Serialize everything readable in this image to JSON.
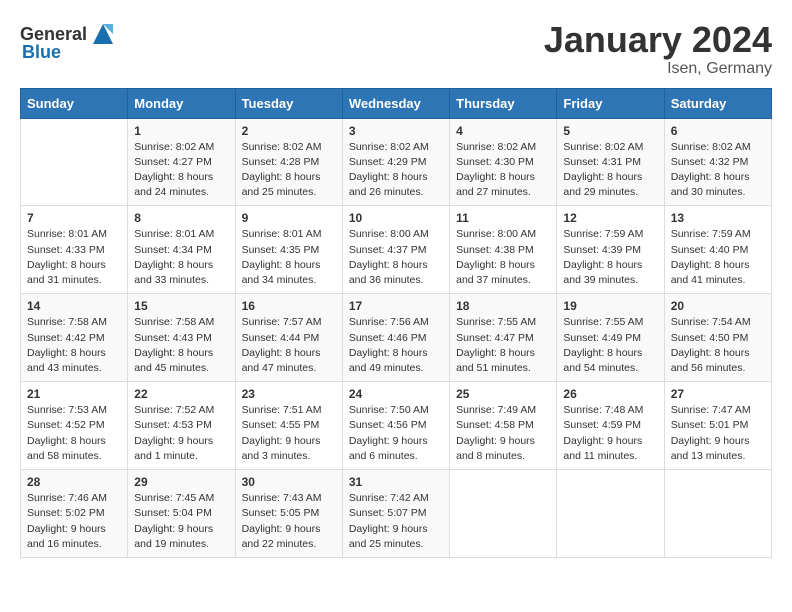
{
  "header": {
    "logo_general": "General",
    "logo_blue": "Blue",
    "month_title": "January 2024",
    "location": "Isen, Germany"
  },
  "weekdays": [
    "Sunday",
    "Monday",
    "Tuesday",
    "Wednesday",
    "Thursday",
    "Friday",
    "Saturday"
  ],
  "weeks": [
    [
      {
        "day": "",
        "info": ""
      },
      {
        "day": "1",
        "info": "Sunrise: 8:02 AM\nSunset: 4:27 PM\nDaylight: 8 hours\nand 24 minutes."
      },
      {
        "day": "2",
        "info": "Sunrise: 8:02 AM\nSunset: 4:28 PM\nDaylight: 8 hours\nand 25 minutes."
      },
      {
        "day": "3",
        "info": "Sunrise: 8:02 AM\nSunset: 4:29 PM\nDaylight: 8 hours\nand 26 minutes."
      },
      {
        "day": "4",
        "info": "Sunrise: 8:02 AM\nSunset: 4:30 PM\nDaylight: 8 hours\nand 27 minutes."
      },
      {
        "day": "5",
        "info": "Sunrise: 8:02 AM\nSunset: 4:31 PM\nDaylight: 8 hours\nand 29 minutes."
      },
      {
        "day": "6",
        "info": "Sunrise: 8:02 AM\nSunset: 4:32 PM\nDaylight: 8 hours\nand 30 minutes."
      }
    ],
    [
      {
        "day": "7",
        "info": "Sunrise: 8:01 AM\nSunset: 4:33 PM\nDaylight: 8 hours\nand 31 minutes."
      },
      {
        "day": "8",
        "info": "Sunrise: 8:01 AM\nSunset: 4:34 PM\nDaylight: 8 hours\nand 33 minutes."
      },
      {
        "day": "9",
        "info": "Sunrise: 8:01 AM\nSunset: 4:35 PM\nDaylight: 8 hours\nand 34 minutes."
      },
      {
        "day": "10",
        "info": "Sunrise: 8:00 AM\nSunset: 4:37 PM\nDaylight: 8 hours\nand 36 minutes."
      },
      {
        "day": "11",
        "info": "Sunrise: 8:00 AM\nSunset: 4:38 PM\nDaylight: 8 hours\nand 37 minutes."
      },
      {
        "day": "12",
        "info": "Sunrise: 7:59 AM\nSunset: 4:39 PM\nDaylight: 8 hours\nand 39 minutes."
      },
      {
        "day": "13",
        "info": "Sunrise: 7:59 AM\nSunset: 4:40 PM\nDaylight: 8 hours\nand 41 minutes."
      }
    ],
    [
      {
        "day": "14",
        "info": "Sunrise: 7:58 AM\nSunset: 4:42 PM\nDaylight: 8 hours\nand 43 minutes."
      },
      {
        "day": "15",
        "info": "Sunrise: 7:58 AM\nSunset: 4:43 PM\nDaylight: 8 hours\nand 45 minutes."
      },
      {
        "day": "16",
        "info": "Sunrise: 7:57 AM\nSunset: 4:44 PM\nDaylight: 8 hours\nand 47 minutes."
      },
      {
        "day": "17",
        "info": "Sunrise: 7:56 AM\nSunset: 4:46 PM\nDaylight: 8 hours\nand 49 minutes."
      },
      {
        "day": "18",
        "info": "Sunrise: 7:55 AM\nSunset: 4:47 PM\nDaylight: 8 hours\nand 51 minutes."
      },
      {
        "day": "19",
        "info": "Sunrise: 7:55 AM\nSunset: 4:49 PM\nDaylight: 8 hours\nand 54 minutes."
      },
      {
        "day": "20",
        "info": "Sunrise: 7:54 AM\nSunset: 4:50 PM\nDaylight: 8 hours\nand 56 minutes."
      }
    ],
    [
      {
        "day": "21",
        "info": "Sunrise: 7:53 AM\nSunset: 4:52 PM\nDaylight: 8 hours\nand 58 minutes."
      },
      {
        "day": "22",
        "info": "Sunrise: 7:52 AM\nSunset: 4:53 PM\nDaylight: 9 hours\nand 1 minute."
      },
      {
        "day": "23",
        "info": "Sunrise: 7:51 AM\nSunset: 4:55 PM\nDaylight: 9 hours\nand 3 minutes."
      },
      {
        "day": "24",
        "info": "Sunrise: 7:50 AM\nSunset: 4:56 PM\nDaylight: 9 hours\nand 6 minutes."
      },
      {
        "day": "25",
        "info": "Sunrise: 7:49 AM\nSunset: 4:58 PM\nDaylight: 9 hours\nand 8 minutes."
      },
      {
        "day": "26",
        "info": "Sunrise: 7:48 AM\nSunset: 4:59 PM\nDaylight: 9 hours\nand 11 minutes."
      },
      {
        "day": "27",
        "info": "Sunrise: 7:47 AM\nSunset: 5:01 PM\nDaylight: 9 hours\nand 13 minutes."
      }
    ],
    [
      {
        "day": "28",
        "info": "Sunrise: 7:46 AM\nSunset: 5:02 PM\nDaylight: 9 hours\nand 16 minutes."
      },
      {
        "day": "29",
        "info": "Sunrise: 7:45 AM\nSunset: 5:04 PM\nDaylight: 9 hours\nand 19 minutes."
      },
      {
        "day": "30",
        "info": "Sunrise: 7:43 AM\nSunset: 5:05 PM\nDaylight: 9 hours\nand 22 minutes."
      },
      {
        "day": "31",
        "info": "Sunrise: 7:42 AM\nSunset: 5:07 PM\nDaylight: 9 hours\nand 25 minutes."
      },
      {
        "day": "",
        "info": ""
      },
      {
        "day": "",
        "info": ""
      },
      {
        "day": "",
        "info": ""
      }
    ]
  ]
}
